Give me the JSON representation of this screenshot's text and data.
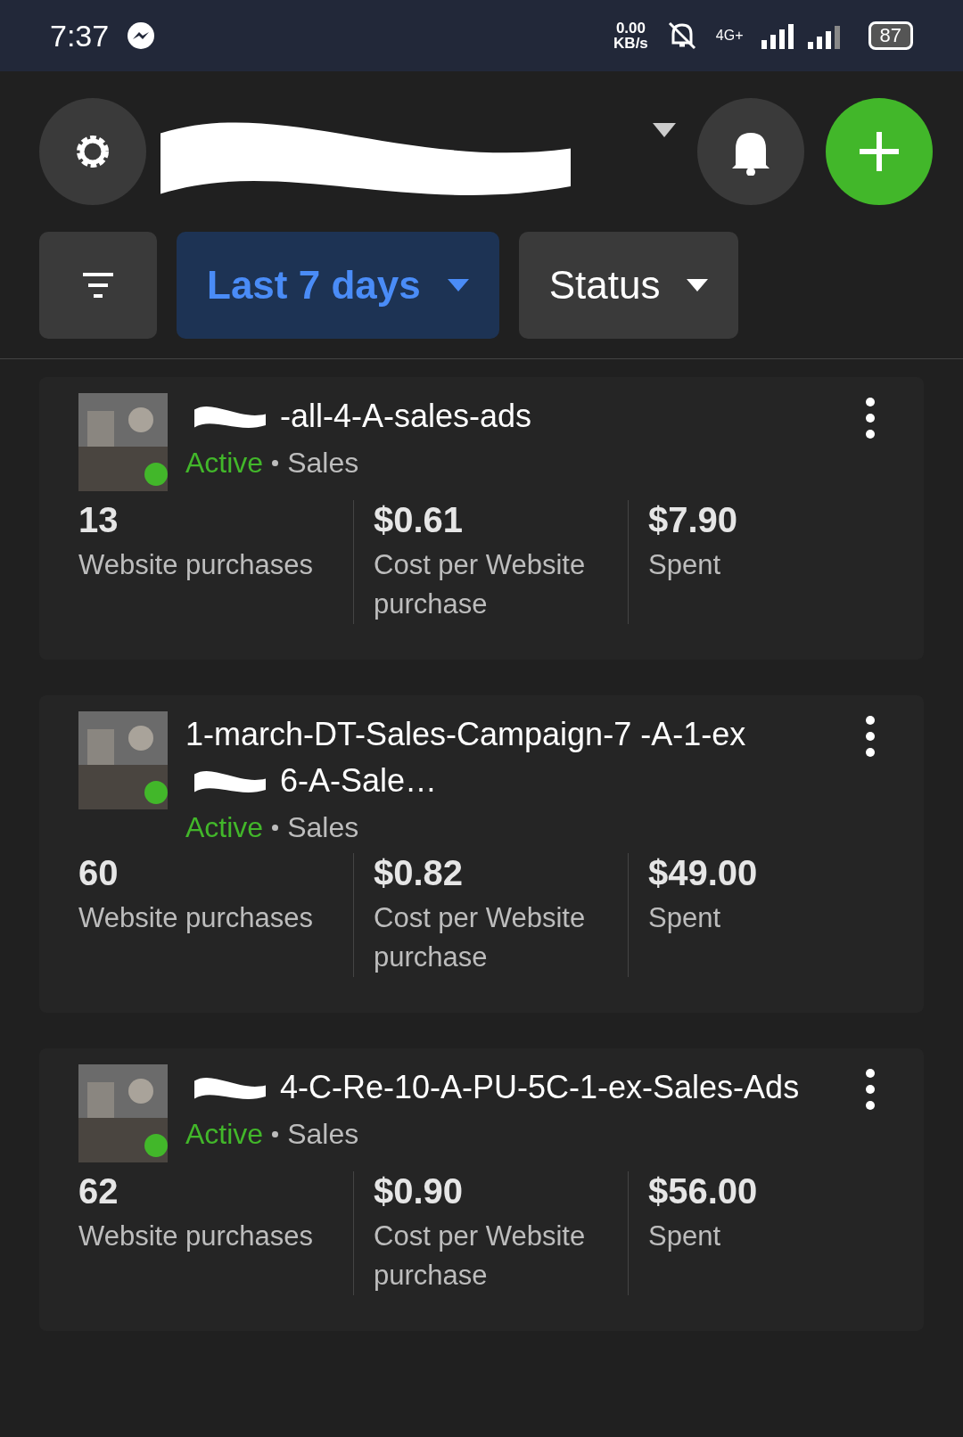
{
  "status_bar": {
    "time": "7:37",
    "data_rate": "0.00",
    "data_unit": "KB/s",
    "network": "4G+",
    "battery": "87"
  },
  "filters": [
    {
      "kind": "icon"
    },
    {
      "kind": "dropdown",
      "label": "Last 7 days",
      "selected": true
    },
    {
      "kind": "dropdown",
      "label": "Status",
      "selected": false
    }
  ],
  "campaigns": [
    {
      "title": [
        {
          "kind": "redaction"
        },
        {
          "kind": "text",
          "text": "-all-4-A-sales-ads"
        }
      ],
      "status": "Active",
      "objective": "Sales",
      "color": "#42b72a",
      "metrics": [
        {
          "value": "13",
          "label": "Website purchases"
        },
        {
          "value": "$0.61",
          "label": "Cost per Website purchase"
        },
        {
          "value": "$7.90",
          "label": "Spent"
        }
      ]
    },
    {
      "title": [
        {
          "kind": "text",
          "text": "1-march-DT-Sales-Campaign-7 -A-1-ex"
        },
        {
          "kind": "redaction"
        },
        {
          "kind": "text",
          "text": "6-A-Sale…"
        }
      ],
      "status": "Active",
      "objective": "Sales",
      "color": "#42b72a",
      "metrics": [
        {
          "value": "60",
          "label": "Website purchases"
        },
        {
          "value": "$0.82",
          "label": "Cost per Website purchase"
        },
        {
          "value": "$49.00",
          "label": "Spent"
        }
      ]
    },
    {
      "title": [
        {
          "kind": "redaction"
        },
        {
          "kind": "text",
          "text": "4-C-Re-10-A-PU-5C-1-ex-Sales-Ads"
        }
      ],
      "status": "Active",
      "objective": "Sales",
      "color": "#42b72a",
      "metrics": [
        {
          "value": "62",
          "label": "Website purchases"
        },
        {
          "value": "$0.90",
          "label": "Cost per Website purchase"
        },
        {
          "value": "$56.00",
          "label": "Spent"
        }
      ]
    }
  ]
}
